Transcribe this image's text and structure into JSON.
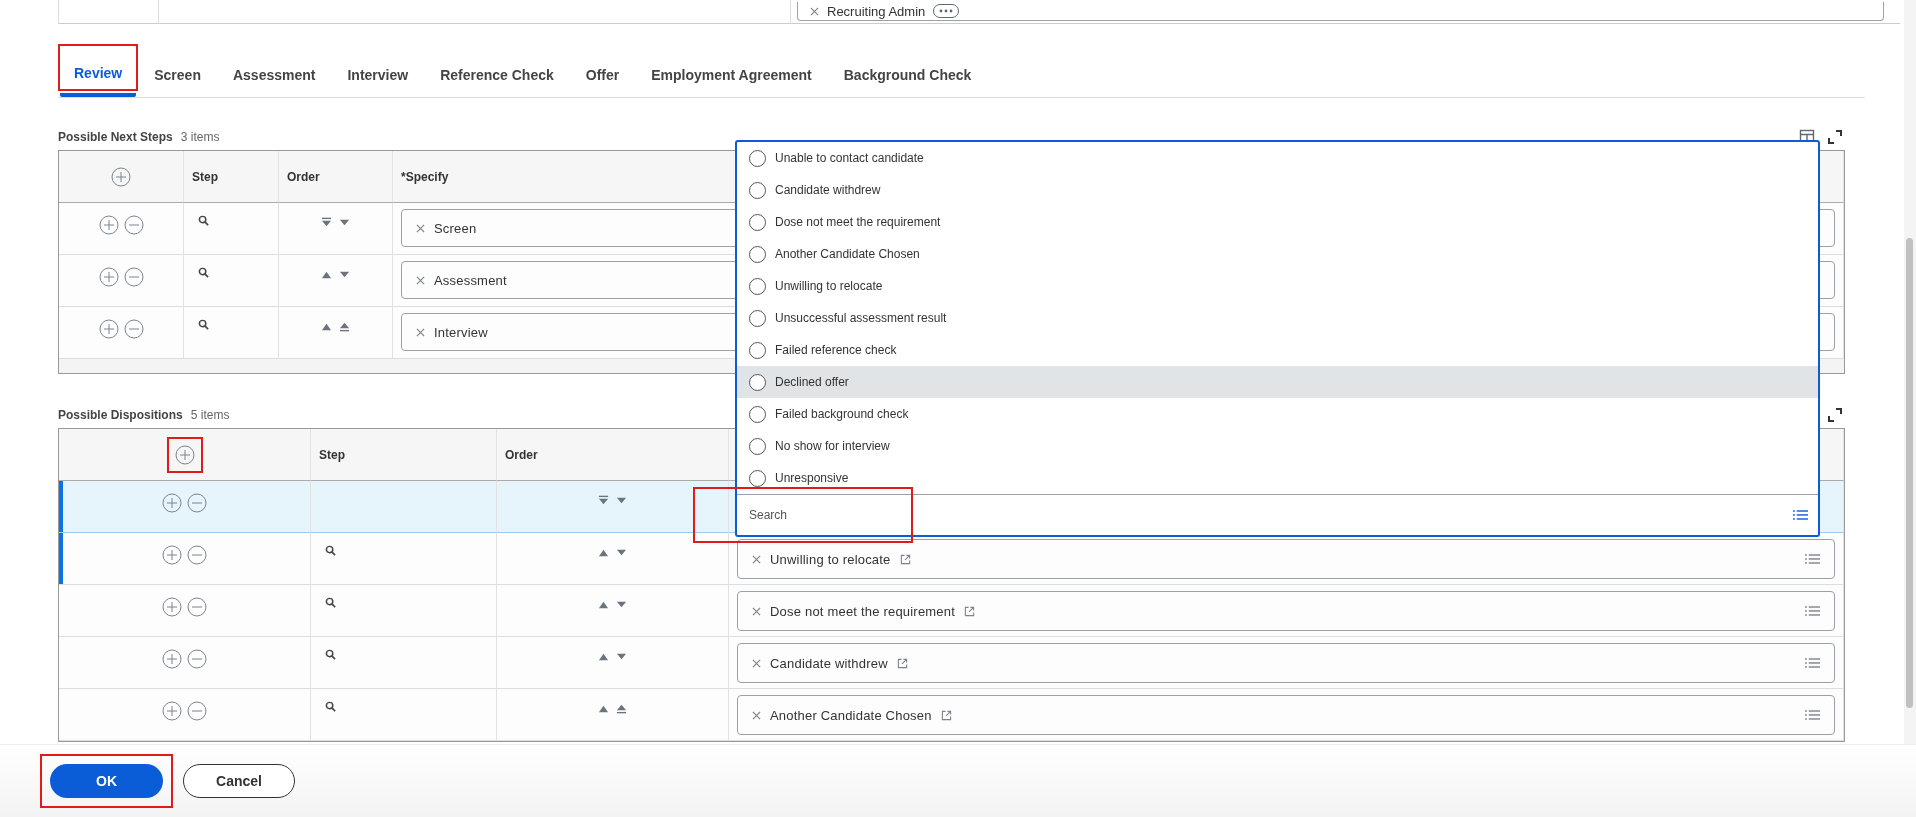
{
  "top_field": {
    "value": "Recruiting Admin"
  },
  "tabs": [
    {
      "label": "Review",
      "selected": true,
      "highlighted": true
    },
    {
      "label": "Screen",
      "selected": false,
      "highlighted": false
    },
    {
      "label": "Assessment",
      "selected": false,
      "highlighted": false
    },
    {
      "label": "Interview",
      "selected": false,
      "highlighted": false
    },
    {
      "label": "Reference Check",
      "selected": false,
      "highlighted": false
    },
    {
      "label": "Offer",
      "selected": false,
      "highlighted": false
    },
    {
      "label": "Employment Agreement",
      "selected": false,
      "highlighted": false
    },
    {
      "label": "Background Check",
      "selected": false,
      "highlighted": false
    }
  ],
  "next_steps": {
    "title": "Possible Next Steps",
    "count": "3 items",
    "columns": [
      "Step",
      "Order",
      "*Specify"
    ],
    "rows": [
      {
        "first": true,
        "last": false,
        "value": "Screen"
      },
      {
        "first": false,
        "last": false,
        "value": "Assessment"
      },
      {
        "first": false,
        "last": true,
        "value": "Interview"
      }
    ]
  },
  "dispositions": {
    "title": "Possible Dispositions",
    "count": "5 items",
    "add_highlighted": true,
    "columns": [
      "Step",
      "Order"
    ],
    "rows": [
      {
        "kind": "editing",
        "first": true,
        "last": false,
        "selected": true,
        "flagged": true
      },
      {
        "kind": "value",
        "first": false,
        "last": false,
        "selected": false,
        "flagged": true,
        "value": "Unwilling to relocate"
      },
      {
        "kind": "value",
        "first": false,
        "last": false,
        "selected": false,
        "flagged": false,
        "value": "Dose not meet the requirement"
      },
      {
        "kind": "value",
        "first": false,
        "last": false,
        "selected": false,
        "flagged": false,
        "value": "Candidate withdrew"
      },
      {
        "kind": "value",
        "first": false,
        "last": true,
        "selected": false,
        "flagged": false,
        "value": "Another Candidate Chosen"
      }
    ]
  },
  "dropdown": {
    "options": [
      {
        "label": "Unable to contact candidate",
        "hovered": false
      },
      {
        "label": "Candidate withdrew",
        "hovered": false
      },
      {
        "label": "Dose not meet the requirement",
        "hovered": false
      },
      {
        "label": "Another Candidate Chosen",
        "hovered": false
      },
      {
        "label": "Unwilling to relocate",
        "hovered": false
      },
      {
        "label": "Unsuccessful assessment result",
        "hovered": false
      },
      {
        "label": "Failed reference check",
        "hovered": false
      },
      {
        "label": "Declined offer",
        "hovered": true
      },
      {
        "label": "Failed background check",
        "hovered": false
      },
      {
        "label": "No show for interview",
        "hovered": false
      },
      {
        "label": "Unresponsive",
        "hovered": false
      }
    ],
    "search": {
      "placeholder": "Search",
      "highlighted": true
    }
  },
  "footer": {
    "buttons": [
      {
        "label": "OK",
        "kind": "primary",
        "highlighted": true
      },
      {
        "label": "Cancel",
        "kind": "secondary",
        "highlighted": false
      }
    ]
  }
}
